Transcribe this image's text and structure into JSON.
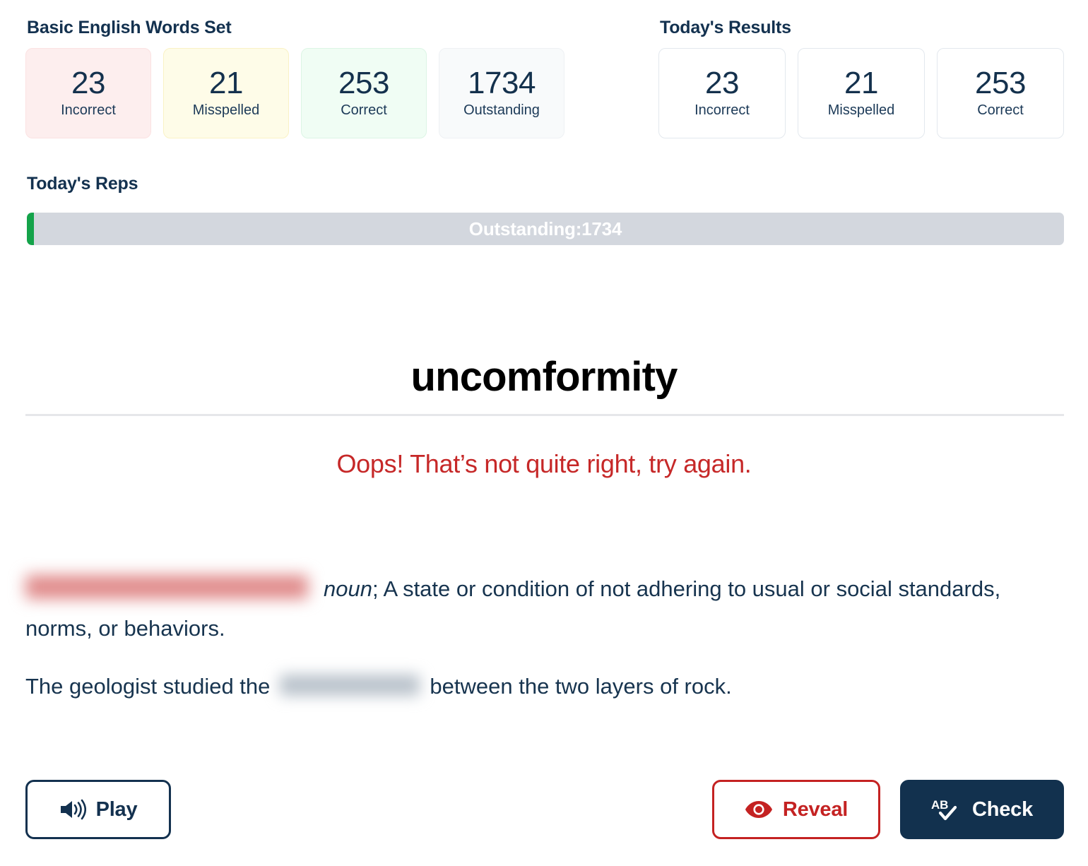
{
  "set_panel": {
    "title": "Basic English Words Set",
    "cards": [
      {
        "value": "23",
        "label": "Incorrect"
      },
      {
        "value": "21",
        "label": "Misspelled"
      },
      {
        "value": "253",
        "label": "Correct"
      },
      {
        "value": "1734",
        "label": "Outstanding"
      }
    ]
  },
  "results_panel": {
    "title": "Today's Results",
    "cards": [
      {
        "value": "23",
        "label": "Incorrect"
      },
      {
        "value": "21",
        "label": "Misspelled"
      },
      {
        "value": "253",
        "label": "Correct"
      }
    ]
  },
  "reps": {
    "title": "Today's Reps",
    "bar_label": "Outstanding:1734",
    "fill_percent": "0.7",
    "fill_color": "#14a34a",
    "track_color": "#d3d7de"
  },
  "quiz": {
    "word": "uncomformity",
    "feedback": "Oops! That’s not quite right, try again.",
    "feedback_color": "#c62828",
    "definition_pos": "noun",
    "definition_text": "; A state or condition of not adhering to usual or social standards, norms, or behaviors.",
    "example_before": "The geologist studied the",
    "example_after": "between the two layers of rock."
  },
  "actions": {
    "play_label": "Play",
    "reveal_label": "Reveal",
    "check_label": "Check",
    "check_icon_text": "AB"
  }
}
